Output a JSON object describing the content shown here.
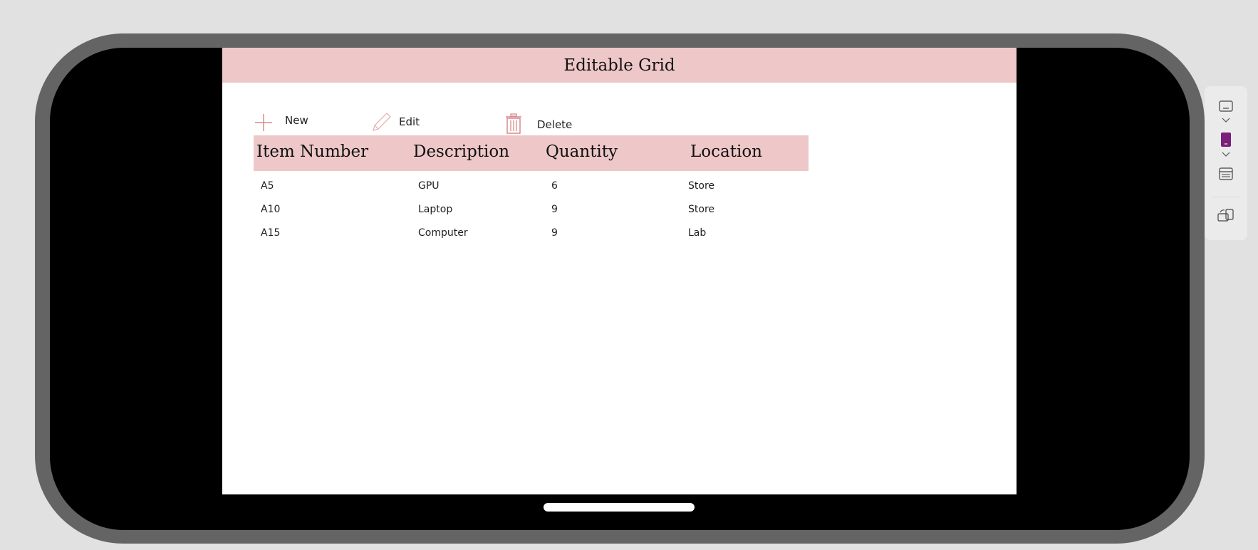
{
  "app": {
    "title": "Editable Grid"
  },
  "toolbar": {
    "new_label": "New",
    "edit_label": "Edit",
    "delete_label": "Delete",
    "icons": [
      "plus-icon",
      "pencil-icon",
      "trash-icon"
    ]
  },
  "grid": {
    "columns": [
      "Item Number",
      "Description",
      "Quantity",
      "Location"
    ],
    "rows": [
      [
        "A5",
        "GPU",
        "6",
        "Store"
      ],
      [
        "A10",
        "Laptop",
        "9",
        "Store"
      ],
      [
        "A15",
        "Computer",
        "9",
        "Lab"
      ]
    ]
  },
  "side_panel": {
    "icons": [
      "screen-icon",
      "chevron-down-icon",
      "phone-icon",
      "chevron-down-icon",
      "layout-icon",
      "rotate-device-icon"
    ]
  },
  "colors": {
    "accent": "#eec8c8",
    "icon": "#d98a8f",
    "frame": "#646464",
    "selected_device": "#7a1f7a"
  }
}
